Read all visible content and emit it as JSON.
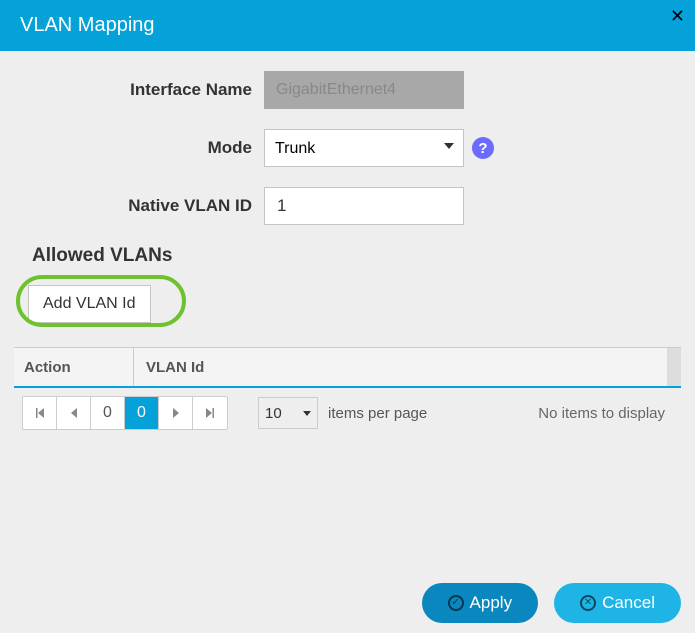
{
  "title": "VLAN Mapping",
  "form": {
    "interface_name_label": "Interface Name",
    "interface_name_value": "GigabitEthernet4",
    "mode_label": "Mode",
    "mode_options": [
      "Trunk"
    ],
    "mode_value": "Trunk",
    "native_vlan_label": "Native VLAN ID",
    "native_vlan_value": "1"
  },
  "allowed_vlans": {
    "title": "Allowed VLANs",
    "add_button": "Add VLAN Id"
  },
  "table": {
    "columns": {
      "action": "Action",
      "vlan_id": "VLAN Id"
    },
    "rows": []
  },
  "pager": {
    "page_left": "0",
    "page_current": "0",
    "page_size": "10",
    "items_per_page_label": "items per page",
    "no_items_label": "No items to display"
  },
  "buttons": {
    "apply": "Apply",
    "cancel": "Cancel"
  },
  "icons": {
    "close": "✕",
    "help": "?",
    "check": "✓",
    "cross": "✕"
  }
}
